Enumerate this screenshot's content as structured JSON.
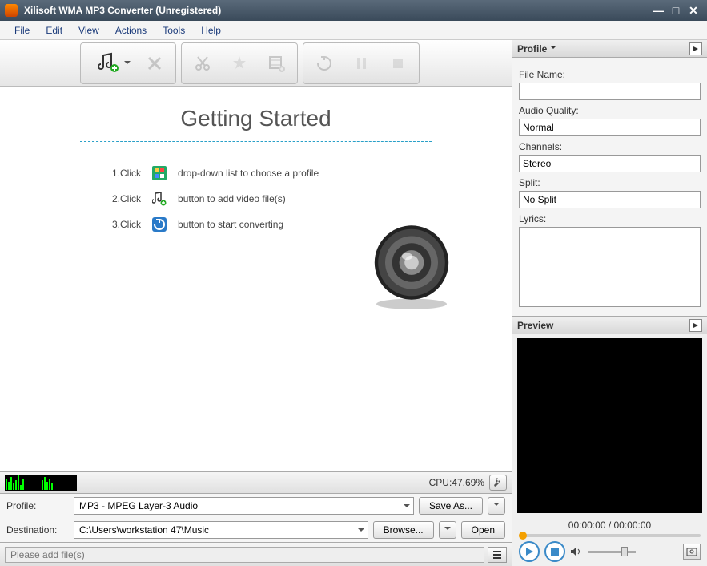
{
  "window": {
    "title": "Xilisoft WMA MP3 Converter (Unregistered)"
  },
  "menu": {
    "file": "File",
    "edit": "Edit",
    "view": "View",
    "actions": "Actions",
    "tools": "Tools",
    "help": "Help"
  },
  "toolbar": {
    "add": "add-files",
    "delete": "delete",
    "cut": "cut",
    "effects": "effects",
    "clip": "clip",
    "convert": "convert",
    "pause": "pause",
    "stop": "stop"
  },
  "getting_started": {
    "title": "Getting Started",
    "steps": [
      {
        "num": "1.Click",
        "text": "drop-down list to choose a profile"
      },
      {
        "num": "2.Click",
        "text": "button to add video file(s)"
      },
      {
        "num": "3.Click",
        "text": "button to start converting"
      }
    ]
  },
  "status": {
    "cpu": "CPU:47.69%"
  },
  "profile": {
    "label": "Profile:",
    "value": "MP3 - MPEG Layer-3 Audio",
    "save_as": "Save As...",
    "dest_label": "Destination:",
    "dest_value": "C:\\Users\\workstation 47\\Music",
    "browse": "Browse...",
    "open": "Open"
  },
  "bottom": {
    "placeholder": "Please add file(s)"
  },
  "right": {
    "profile_header": "Profile",
    "file_name_label": "File Name:",
    "file_name_value": "",
    "audio_quality_label": "Audio Quality:",
    "audio_quality_value": "Normal",
    "channels_label": "Channels:",
    "channels_value": "Stereo",
    "split_label": "Split:",
    "split_value": "No Split",
    "lyrics_label": "Lyrics:",
    "lyrics_value": "",
    "preview_header": "Preview",
    "time": "00:00:00 / 00:00:00"
  }
}
